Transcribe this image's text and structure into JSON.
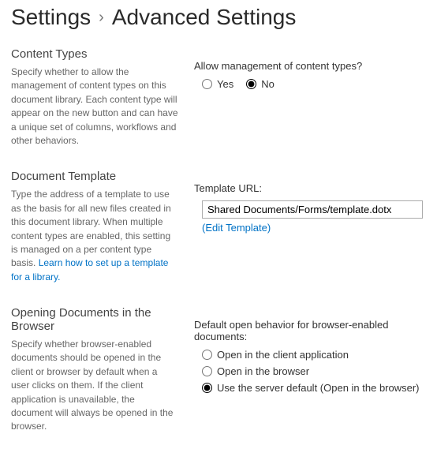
{
  "breadcrumb": {
    "root": "Settings",
    "current": "Advanced Settings"
  },
  "sections": {
    "contentTypes": {
      "title": "Content Types",
      "desc": "Specify whether to allow the management of content types on this document library. Each content type will appear on the new button and can have a unique set of columns, workflows and other behaviors.",
      "fieldLabel": "Allow management of content types?",
      "options": {
        "yes": "Yes",
        "no": "No"
      }
    },
    "docTemplate": {
      "title": "Document Template",
      "desc": "Type the address of a template to use as the basis for all new files created in this document library. When multiple content types are enabled, this setting is managed on a per content type basis. ",
      "learnLink": "Learn how to set up a template for a library.",
      "fieldLabel": "Template URL:",
      "value": "Shared Documents/Forms/template.dotx",
      "editLink": "(Edit Template)"
    },
    "openBehavior": {
      "title": "Opening Documents in the Browser",
      "desc": "Specify whether browser-enabled documents should be opened in the client or browser by default when a user clicks on them. If the client application is unavailable, the document will always be opened in the browser.",
      "fieldLabel": "Default open behavior for browser-enabled documents:",
      "options": {
        "client": "Open in the client application",
        "browser": "Open in the browser",
        "server": "Use the server default (Open in the browser)"
      }
    }
  }
}
